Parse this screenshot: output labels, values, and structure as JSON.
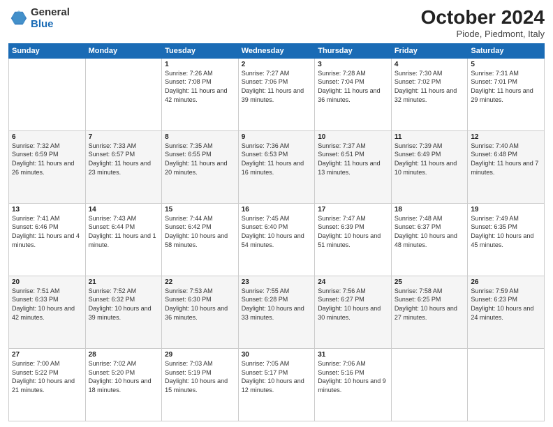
{
  "header": {
    "logo_general": "General",
    "logo_blue": "Blue",
    "title": "October 2024",
    "subtitle": "Piode, Piedmont, Italy"
  },
  "days_of_week": [
    "Sunday",
    "Monday",
    "Tuesday",
    "Wednesday",
    "Thursday",
    "Friday",
    "Saturday"
  ],
  "weeks": [
    [
      {
        "day": "",
        "info": ""
      },
      {
        "day": "",
        "info": ""
      },
      {
        "day": "1",
        "info": "Sunrise: 7:26 AM\nSunset: 7:08 PM\nDaylight: 11 hours and 42 minutes."
      },
      {
        "day": "2",
        "info": "Sunrise: 7:27 AM\nSunset: 7:06 PM\nDaylight: 11 hours and 39 minutes."
      },
      {
        "day": "3",
        "info": "Sunrise: 7:28 AM\nSunset: 7:04 PM\nDaylight: 11 hours and 36 minutes."
      },
      {
        "day": "4",
        "info": "Sunrise: 7:30 AM\nSunset: 7:02 PM\nDaylight: 11 hours and 32 minutes."
      },
      {
        "day": "5",
        "info": "Sunrise: 7:31 AM\nSunset: 7:01 PM\nDaylight: 11 hours and 29 minutes."
      }
    ],
    [
      {
        "day": "6",
        "info": "Sunrise: 7:32 AM\nSunset: 6:59 PM\nDaylight: 11 hours and 26 minutes."
      },
      {
        "day": "7",
        "info": "Sunrise: 7:33 AM\nSunset: 6:57 PM\nDaylight: 11 hours and 23 minutes."
      },
      {
        "day": "8",
        "info": "Sunrise: 7:35 AM\nSunset: 6:55 PM\nDaylight: 11 hours and 20 minutes."
      },
      {
        "day": "9",
        "info": "Sunrise: 7:36 AM\nSunset: 6:53 PM\nDaylight: 11 hours and 16 minutes."
      },
      {
        "day": "10",
        "info": "Sunrise: 7:37 AM\nSunset: 6:51 PM\nDaylight: 11 hours and 13 minutes."
      },
      {
        "day": "11",
        "info": "Sunrise: 7:39 AM\nSunset: 6:49 PM\nDaylight: 11 hours and 10 minutes."
      },
      {
        "day": "12",
        "info": "Sunrise: 7:40 AM\nSunset: 6:48 PM\nDaylight: 11 hours and 7 minutes."
      }
    ],
    [
      {
        "day": "13",
        "info": "Sunrise: 7:41 AM\nSunset: 6:46 PM\nDaylight: 11 hours and 4 minutes."
      },
      {
        "day": "14",
        "info": "Sunrise: 7:43 AM\nSunset: 6:44 PM\nDaylight: 11 hours and 1 minute."
      },
      {
        "day": "15",
        "info": "Sunrise: 7:44 AM\nSunset: 6:42 PM\nDaylight: 10 hours and 58 minutes."
      },
      {
        "day": "16",
        "info": "Sunrise: 7:45 AM\nSunset: 6:40 PM\nDaylight: 10 hours and 54 minutes."
      },
      {
        "day": "17",
        "info": "Sunrise: 7:47 AM\nSunset: 6:39 PM\nDaylight: 10 hours and 51 minutes."
      },
      {
        "day": "18",
        "info": "Sunrise: 7:48 AM\nSunset: 6:37 PM\nDaylight: 10 hours and 48 minutes."
      },
      {
        "day": "19",
        "info": "Sunrise: 7:49 AM\nSunset: 6:35 PM\nDaylight: 10 hours and 45 minutes."
      }
    ],
    [
      {
        "day": "20",
        "info": "Sunrise: 7:51 AM\nSunset: 6:33 PM\nDaylight: 10 hours and 42 minutes."
      },
      {
        "day": "21",
        "info": "Sunrise: 7:52 AM\nSunset: 6:32 PM\nDaylight: 10 hours and 39 minutes."
      },
      {
        "day": "22",
        "info": "Sunrise: 7:53 AM\nSunset: 6:30 PM\nDaylight: 10 hours and 36 minutes."
      },
      {
        "day": "23",
        "info": "Sunrise: 7:55 AM\nSunset: 6:28 PM\nDaylight: 10 hours and 33 minutes."
      },
      {
        "day": "24",
        "info": "Sunrise: 7:56 AM\nSunset: 6:27 PM\nDaylight: 10 hours and 30 minutes."
      },
      {
        "day": "25",
        "info": "Sunrise: 7:58 AM\nSunset: 6:25 PM\nDaylight: 10 hours and 27 minutes."
      },
      {
        "day": "26",
        "info": "Sunrise: 7:59 AM\nSunset: 6:23 PM\nDaylight: 10 hours and 24 minutes."
      }
    ],
    [
      {
        "day": "27",
        "info": "Sunrise: 7:00 AM\nSunset: 5:22 PM\nDaylight: 10 hours and 21 minutes."
      },
      {
        "day": "28",
        "info": "Sunrise: 7:02 AM\nSunset: 5:20 PM\nDaylight: 10 hours and 18 minutes."
      },
      {
        "day": "29",
        "info": "Sunrise: 7:03 AM\nSunset: 5:19 PM\nDaylight: 10 hours and 15 minutes."
      },
      {
        "day": "30",
        "info": "Sunrise: 7:05 AM\nSunset: 5:17 PM\nDaylight: 10 hours and 12 minutes."
      },
      {
        "day": "31",
        "info": "Sunrise: 7:06 AM\nSunset: 5:16 PM\nDaylight: 10 hours and 9 minutes."
      },
      {
        "day": "",
        "info": ""
      },
      {
        "day": "",
        "info": ""
      }
    ]
  ]
}
